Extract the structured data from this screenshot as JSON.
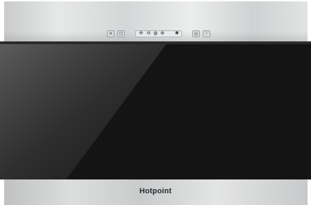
{
  "product": {
    "brand": "Hotpoint"
  },
  "controls": {
    "left_buttons": [
      {
        "icon": "fan-off-icon",
        "glyph": "✕"
      },
      {
        "icon": "delay-timer-icon",
        "glyph": "⊡"
      }
    ],
    "display_icons": [
      {
        "icon": "fan-speed-icon",
        "glyph": "✣"
      },
      {
        "icon": "minus-icon",
        "glyph": "⊖"
      },
      {
        "icon": "speed-level-icon",
        "glyph": "◍"
      },
      {
        "icon": "plus-icon",
        "glyph": "⊕"
      },
      {
        "icon": "boost-icon",
        "glyph": "✺"
      }
    ],
    "right_buttons": [
      {
        "icon": "power-icon",
        "glyph": "◎"
      },
      {
        "icon": "light-icon",
        "glyph": "♡"
      }
    ]
  },
  "colors": {
    "glass": "#141414",
    "steel": "#d6d8d9",
    "brand_text": "#2a2b2c"
  }
}
